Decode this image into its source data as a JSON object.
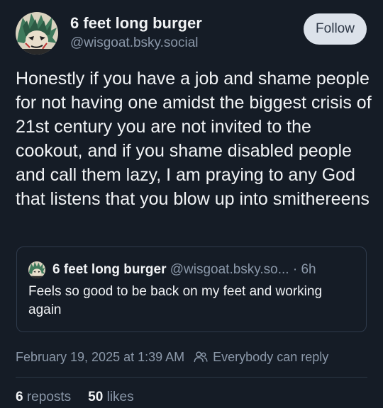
{
  "author": {
    "display_name": "6 feet long burger",
    "handle": "@wisgoat.bsky.social"
  },
  "follow_label": "Follow",
  "post_text": "Honestly if you have a job and shame people for not having one amidst the biggest crisis of 21st century you are not invited to the cookout, and if you shame disabled people and call them lazy, I am praying to any God that listens that you blow up into smithereens",
  "quote": {
    "display_name": "6 feet long burger",
    "handle": "@wisgoat.bsky.so...",
    "separator": "·",
    "time": "6h",
    "text": "Feels so good to be back on my feet and working again"
  },
  "meta": {
    "timestamp": "February 19, 2025 at 1:39 AM",
    "reply_setting": "Everybody can reply",
    "reply_icon": "people-icon"
  },
  "stats": {
    "reposts_count": "6",
    "reposts_label": "reposts",
    "likes_count": "50",
    "likes_label": "likes"
  },
  "colors": {
    "background": "#151c26",
    "text": "#f1f3f5",
    "muted": "#8b98a9",
    "follow_bg": "#dce2ea",
    "border": "#2e3a4b"
  }
}
